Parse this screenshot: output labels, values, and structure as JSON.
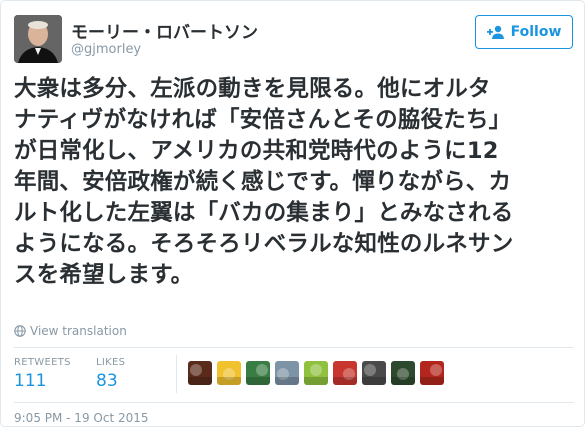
{
  "author": {
    "display_name": "モーリー・ロバートソン",
    "handle": "@gjmorley"
  },
  "follow_button": {
    "label": "Follow",
    "icon": "add-person-icon"
  },
  "tweet": {
    "line1": "大衆は多分、左派の動きを見限る。他にオルタ",
    "line2": "ナティヴがなければ「安倍さんとその脇役たち」",
    "line3": "が日常化し、アメリカの共和党時代のように12",
    "line4": "年間、安倍政権が続く感じです。憚りながら、カ",
    "line5": "ルト化した左翼は「バカの集まり」とみなされる",
    "line6": "ようになる。そろそろリベラルな知性のルネサン",
    "line7": "スを希望します。"
  },
  "translate": {
    "label": "View translation",
    "icon": "globe-icon"
  },
  "stats": {
    "retweets_label": "RETWEETS",
    "retweets_value": "111",
    "likes_label": "LIKES",
    "likes_value": "83"
  },
  "likers": [
    {
      "name": "liker-avatar-1",
      "color": "#5a2b1a"
    },
    {
      "name": "liker-avatar-2",
      "color": "#f2c12e"
    },
    {
      "name": "liker-avatar-3",
      "color": "#3a7d44"
    },
    {
      "name": "liker-avatar-4",
      "color": "#7d93a6"
    },
    {
      "name": "liker-avatar-5",
      "color": "#8fc13f"
    },
    {
      "name": "liker-avatar-6",
      "color": "#c7372f"
    },
    {
      "name": "liker-avatar-7",
      "color": "#4a4a4a"
    },
    {
      "name": "liker-avatar-8",
      "color": "#2e4a2e"
    },
    {
      "name": "liker-avatar-9",
      "color": "#b3261e"
    }
  ],
  "timestamp": "9:05 PM - 19 Oct 2015",
  "colors": {
    "accent": "#1b95e0",
    "muted": "#8899a6",
    "text": "#292f33",
    "border": "#e1e8ed"
  }
}
